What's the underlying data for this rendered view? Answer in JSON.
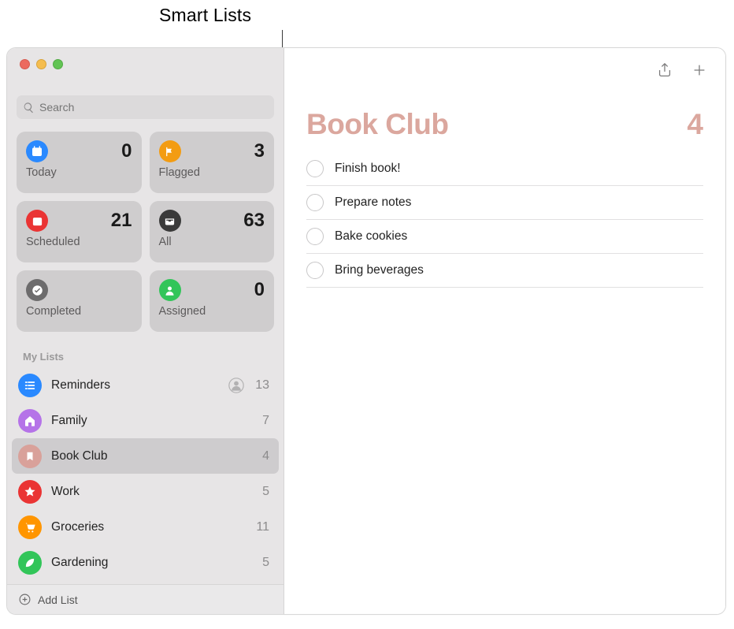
{
  "callout": {
    "label": "Smart Lists"
  },
  "search": {
    "placeholder": "Search"
  },
  "smart": {
    "today": {
      "label": "Today",
      "count": "0"
    },
    "flagged": {
      "label": "Flagged",
      "count": "3"
    },
    "scheduled": {
      "label": "Scheduled",
      "count": "21"
    },
    "all": {
      "label": "All",
      "count": "63"
    },
    "completed": {
      "label": "Completed",
      "count": ""
    },
    "assigned": {
      "label": "Assigned",
      "count": "0"
    }
  },
  "my_lists_header": "My Lists",
  "lists": [
    {
      "name": "Reminders",
      "count": "13",
      "color": "b-blue",
      "icon": "list",
      "shared": true,
      "selected": false
    },
    {
      "name": "Family",
      "count": "7",
      "color": "b-purple",
      "icon": "home",
      "shared": false,
      "selected": false
    },
    {
      "name": "Book Club",
      "count": "4",
      "color": "b-pink",
      "icon": "bookmark",
      "shared": false,
      "selected": true
    },
    {
      "name": "Work",
      "count": "5",
      "color": "b-red",
      "icon": "star",
      "shared": false,
      "selected": false
    },
    {
      "name": "Groceries",
      "count": "11",
      "color": "b-orange",
      "icon": "cart",
      "shared": false,
      "selected": false
    },
    {
      "name": "Gardening",
      "count": "5",
      "color": "b-green",
      "icon": "leaf",
      "shared": false,
      "selected": false
    }
  ],
  "footer": {
    "add_list": "Add List"
  },
  "main": {
    "title": "Book Club",
    "count": "4",
    "items": [
      {
        "text": "Finish book!"
      },
      {
        "text": "Prepare notes"
      },
      {
        "text": "Bake cookies"
      },
      {
        "text": "Bring beverages"
      }
    ],
    "accent": "#dba79e"
  }
}
